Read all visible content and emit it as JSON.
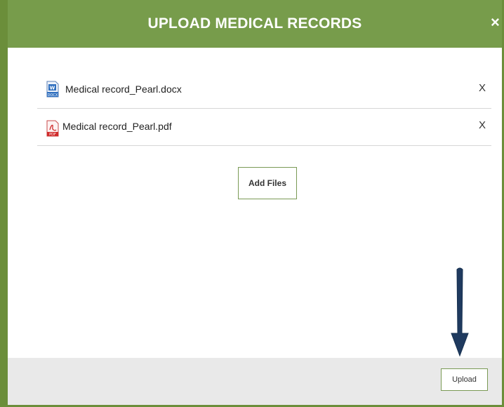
{
  "dialog": {
    "title": "UPLOAD MEDICAL RECORDS",
    "close_glyph": "×"
  },
  "files": [
    {
      "name": "Medical record_Pearl.docx",
      "icon": "docx-file-icon",
      "remove_label": "X"
    },
    {
      "name": "Medical record_Pearl.pdf",
      "icon": "pdf-file-icon",
      "remove_label": "X"
    }
  ],
  "actions": {
    "add_files_label": "Add Files",
    "upload_label": "Upload"
  },
  "annotation": {
    "icon": "down-arrow-icon"
  },
  "colors": {
    "header": "#779c4b",
    "frame": "#6b8e3a",
    "footer": "#e9e9e9",
    "arrow": "#1f3a5f"
  }
}
